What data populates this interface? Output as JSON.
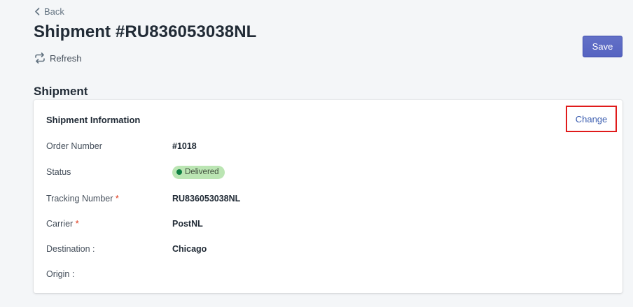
{
  "nav": {
    "back_label": "Back"
  },
  "header": {
    "title": "Shipment #RU836053038NL",
    "refresh_label": "Refresh",
    "save_label": "Save"
  },
  "section": {
    "title": "Shipment"
  },
  "card": {
    "title": "Shipment Information",
    "change_label": "Change",
    "fields": {
      "order_number": {
        "label": "Order Number",
        "value": "#1018"
      },
      "status": {
        "label": "Status",
        "value": "Delivered"
      },
      "tracking_number": {
        "label": "Tracking Number",
        "required_mark": "*",
        "value": "RU836053038NL"
      },
      "carrier": {
        "label": "Carrier",
        "required_mark": "*",
        "value": "PostNL"
      },
      "destination": {
        "label": "Destination :",
        "value": "Chicago"
      },
      "origin": {
        "label": "Origin :",
        "value": ""
      }
    }
  },
  "colors": {
    "primary_button": "#5c6ac4",
    "status_badge_bg": "#bbe5b3",
    "status_dot": "#108043",
    "highlight_border": "#e01b1b",
    "link": "#3d5fb0"
  },
  "icons": {
    "back": "chevron-left-icon",
    "refresh": "refresh-icon"
  }
}
